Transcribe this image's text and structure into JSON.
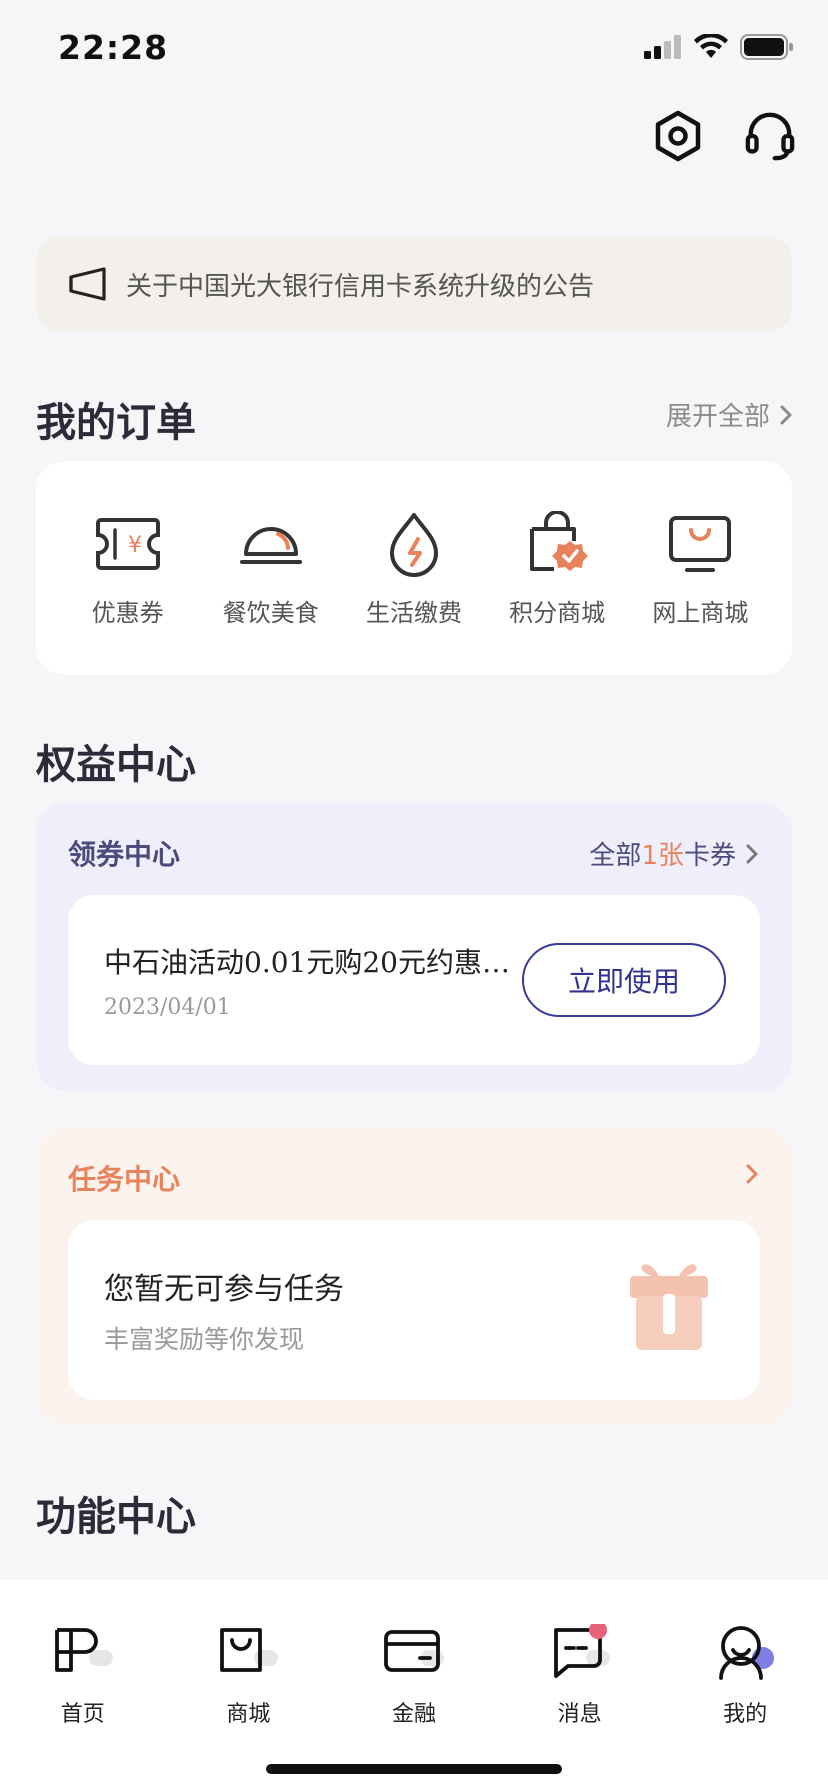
{
  "status_bar": {
    "time": "22:28"
  },
  "notice": {
    "text": "关于中国光大银行信用卡系统升级的公告"
  },
  "orders": {
    "title": "我的订单",
    "expand_label": "展开全部",
    "items": [
      {
        "label": "优惠券",
        "icon": "coupon-ticket-icon"
      },
      {
        "label": "餐饮美食",
        "icon": "food-cloche-icon"
      },
      {
        "label": "生活缴费",
        "icon": "utility-drop-icon"
      },
      {
        "label": "积分商城",
        "icon": "points-bag-icon"
      },
      {
        "label": "网上商城",
        "icon": "online-mall-monitor-icon"
      }
    ]
  },
  "benefits": {
    "title": "权益中心",
    "coupon_center": {
      "title": "领券中心",
      "more_prefix": "全部",
      "more_count": "1张",
      "more_suffix": "卡券",
      "coupon": {
        "name": "中石油活动0.01元购20元约惠…",
        "date": "2023/04/01",
        "button_label": "立即使用"
      }
    },
    "task_center": {
      "title": "任务中心",
      "empty_title": "您暂无可参与任务",
      "empty_subtitle": "丰富奖励等你发现"
    }
  },
  "functions": {
    "title": "功能中心"
  },
  "tabbar": {
    "tabs": [
      {
        "label": "首页",
        "icon": "home-icon"
      },
      {
        "label": "商城",
        "icon": "mall-bag-icon"
      },
      {
        "label": "金融",
        "icon": "wallet-card-icon"
      },
      {
        "label": "消息",
        "icon": "message-bubble-icon"
      },
      {
        "label": "我的",
        "icon": "profile-icon"
      }
    ]
  },
  "colors": {
    "accent_orange": "#e8825a",
    "brand_indigo": "#39399a",
    "coupon_panel_bg": "#efeffb",
    "task_panel_bg": "#fcf3ef"
  }
}
